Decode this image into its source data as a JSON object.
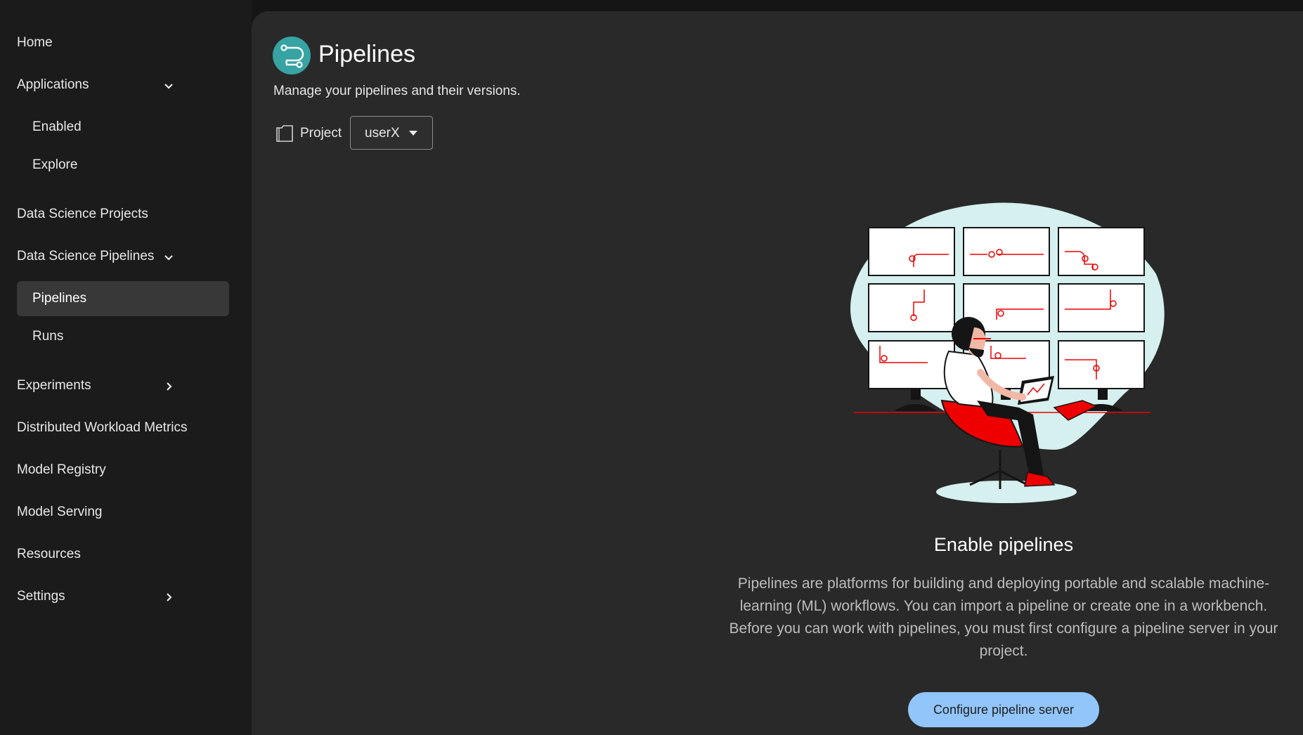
{
  "sidebar": {
    "items": [
      {
        "label": "Home"
      },
      {
        "label": "Applications"
      },
      {
        "label": "Enabled"
      },
      {
        "label": "Explore"
      },
      {
        "label": "Data Science Projects"
      },
      {
        "label": "Data Science Pipelines"
      },
      {
        "label": "Pipelines"
      },
      {
        "label": "Runs"
      },
      {
        "label": "Experiments"
      },
      {
        "label": "Distributed Workload Metrics"
      },
      {
        "label": "Model Registry"
      },
      {
        "label": "Model Serving"
      },
      {
        "label": "Resources"
      },
      {
        "label": "Settings"
      }
    ],
    "active_item": "Pipelines"
  },
  "header": {
    "title": "Pipelines",
    "description": "Manage your pipelines and their versions.",
    "icon": "pipeline-icon"
  },
  "project_selector": {
    "label": "Project",
    "value": "userX"
  },
  "empty_state": {
    "title": "Enable pipelines",
    "body": "Pipelines are platforms for building and deploying portable and scalable machine-learning (ML) workflows. You can import a pipeline or create one in a workbench. Before you can work with pipelines, you must first configure a pipeline server in your project.",
    "button_label": "Configure pipeline server"
  },
  "colors": {
    "accent": "#37a3a3",
    "button": "#92c5f9",
    "illustration_red": "#ee0000"
  }
}
